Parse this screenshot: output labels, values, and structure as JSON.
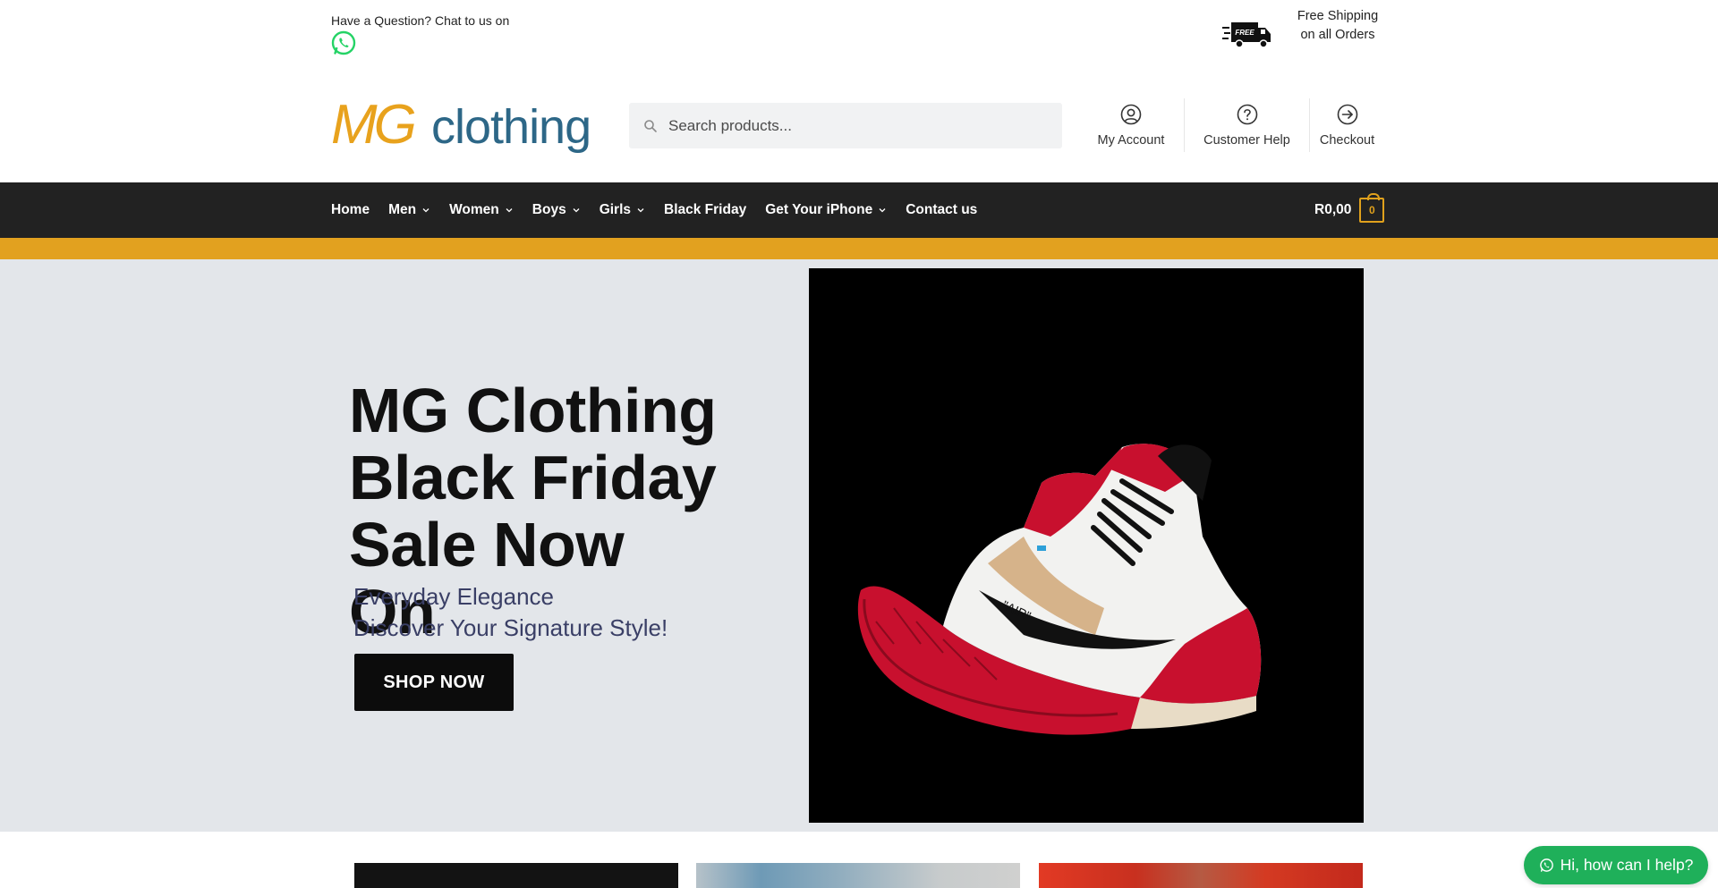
{
  "topbar": {
    "question": "Have a Question? Chat to us on",
    "shipping_line1": "Free Shipping",
    "shipping_line2": "on all Orders",
    "truck_badge": "FREE"
  },
  "logo": {
    "mg": "MG",
    "word": "clothing"
  },
  "search": {
    "placeholder": "Search products..."
  },
  "header_links": [
    {
      "label": "My Account",
      "icon": "user-circle-icon"
    },
    {
      "label": "Customer Help",
      "icon": "help-circle-icon"
    },
    {
      "label": "Checkout",
      "icon": "arrow-circle-icon"
    }
  ],
  "nav": {
    "items": [
      "Home",
      "Men",
      "Women",
      "Boys",
      "Girls",
      "Black Friday",
      "Get Your iPhone",
      "Contact us"
    ],
    "cart_amount": "R0,00",
    "cart_count": "0"
  },
  "hero": {
    "title": "MG Clothing Black Friday Sale Now On",
    "sub1": "Everyday Elegance",
    "sub2": "Discover Your Signature Style!",
    "button": "SHOP NOW"
  },
  "chat": {
    "label": "Hi, how can I help?"
  },
  "colors": {
    "accent": "#e2a11f",
    "nav_bg": "#222222",
    "hero_bg": "#e3e6ea",
    "chat_green": "#1fb05a",
    "whatsapp": "#25d366"
  }
}
